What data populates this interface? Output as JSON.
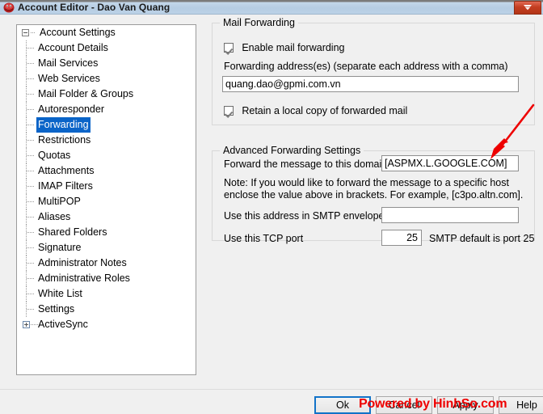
{
  "window": {
    "title": "Account Editor - Dao Van Quang",
    "icon": "mdaemon-app-icon",
    "close_label": "Close"
  },
  "tree": {
    "root": {
      "label": "Account Settings",
      "expander": "minus-expander-icon"
    },
    "items": [
      {
        "label": "Account Details",
        "selected": false
      },
      {
        "label": "Mail Services",
        "selected": false
      },
      {
        "label": "Web Services",
        "selected": false
      },
      {
        "label": "Mail Folder & Groups",
        "selected": false
      },
      {
        "label": "Autoresponder",
        "selected": false
      },
      {
        "label": "Forwarding",
        "selected": true
      },
      {
        "label": "Restrictions",
        "selected": false
      },
      {
        "label": "Quotas",
        "selected": false
      },
      {
        "label": "Attachments",
        "selected": false
      },
      {
        "label": "IMAP Filters",
        "selected": false
      },
      {
        "label": "MultiPOP",
        "selected": false
      },
      {
        "label": "Aliases",
        "selected": false
      },
      {
        "label": "Shared Folders",
        "selected": false
      },
      {
        "label": "Signature",
        "selected": false
      },
      {
        "label": "Administrator Notes",
        "selected": false
      },
      {
        "label": "Administrative Roles",
        "selected": false
      },
      {
        "label": "White List",
        "selected": false
      },
      {
        "label": "Settings",
        "selected": false
      }
    ],
    "last_node": {
      "label": "ActiveSync",
      "expander": "plus-expander-icon"
    }
  },
  "mail_forwarding": {
    "title": "Mail Forwarding",
    "enable_checkbox": {
      "label": "Enable mail forwarding",
      "checked": true
    },
    "address_label": "Forwarding address(es) (separate each address with a comma)",
    "address_value": "quang.dao@gpmi.com.vn",
    "retain_checkbox": {
      "label": "Retain a local copy of forwarded mail",
      "checked": true
    }
  },
  "advanced_forwarding": {
    "title": "Advanced Forwarding Settings",
    "domain_label": "Forward the message to this domain",
    "domain_value": "[ASPMX.L.GOOGLE.COM]",
    "note": "Note:  If you would like to forward the message to a specific host enclose the value above in brackets.  For example, [c3po.altn.com].",
    "smtp_envelope_label": "Use this address in SMTP envelope",
    "smtp_envelope_value": "",
    "tcp_port_label": "Use this TCP port",
    "tcp_port_value": "25",
    "tcp_port_hint": "SMTP default is port 25"
  },
  "buttons": {
    "ok": "Ok",
    "cancel": "Cancel",
    "apply": "Apply",
    "help": "Help"
  },
  "watermark": "Powered by HinhSo.com",
  "colors": {
    "selection_blue": "#0a64c8",
    "titlebar_blue": "#b6cde3",
    "close_red": "#c43e21",
    "annotation_red": "#ee0000",
    "watermark_red": "#ee0000"
  }
}
